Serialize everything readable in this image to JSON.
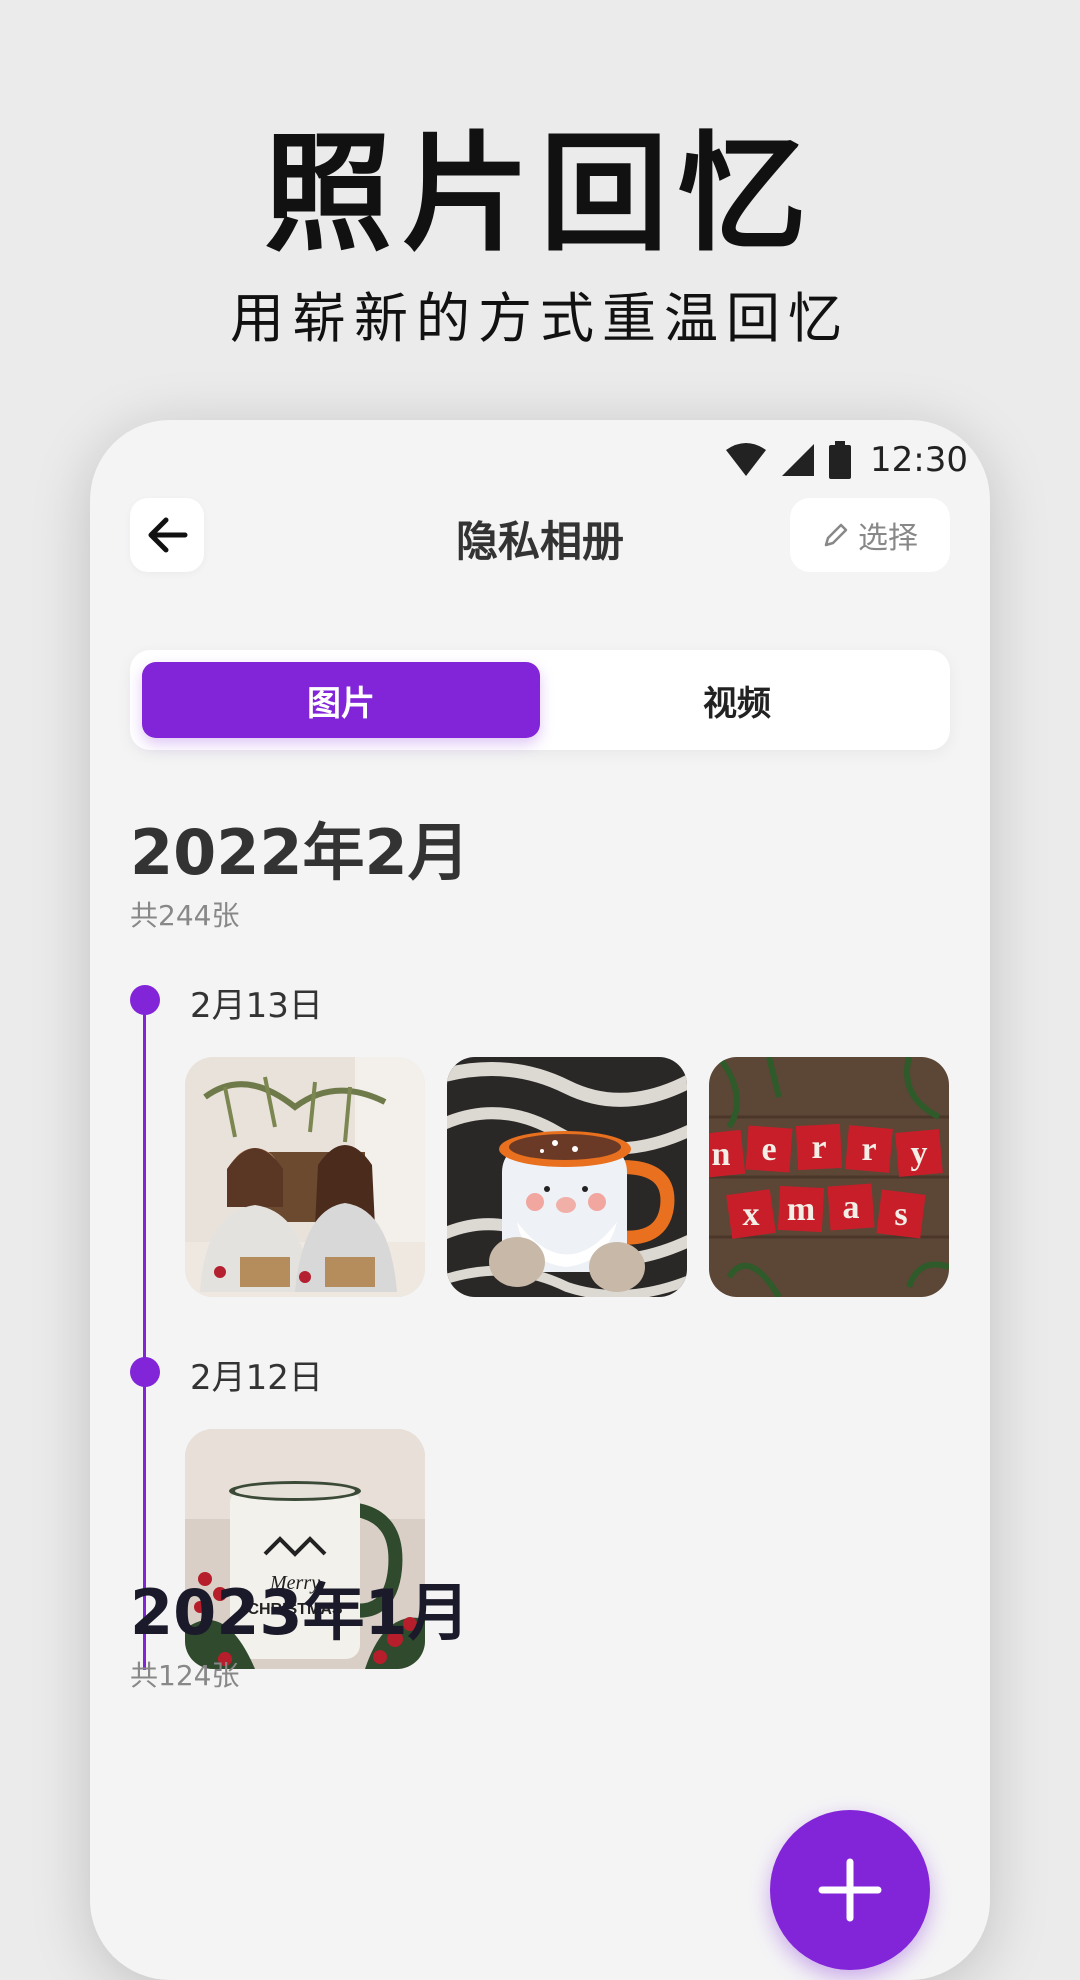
{
  "promo": {
    "title": "照片回忆",
    "subtitle": "用崭新的方式重温回忆"
  },
  "status_bar": {
    "time": "12:30",
    "icons": [
      "wifi-icon",
      "cellular-signal-icon",
      "battery-icon"
    ]
  },
  "header": {
    "back_icon": "arrow-left-icon",
    "title": "隐私相册",
    "select_label": "选择",
    "select_icon": "pencil-icon"
  },
  "tabs": [
    {
      "label": "图片",
      "active": true
    },
    {
      "label": "视频",
      "active": false
    }
  ],
  "sections": [
    {
      "month": "2022年2月",
      "count": "共244张",
      "days": [
        {
          "date": "2月13日",
          "photos": [
            "two-women-wrapping-gifts-photo",
            "santa-mug-cocoa-photo",
            "merry-xmas-letters-photo"
          ]
        },
        {
          "date": "2月12日",
          "photos": [
            "merry-christmas-mug-photo"
          ]
        }
      ]
    },
    {
      "month": "2023年1月",
      "count": "共124张",
      "days": []
    }
  ],
  "fab": {
    "icon": "plus-icon"
  },
  "colors": {
    "accent": "#8224d8",
    "background": "#ebebeb",
    "phone_background": "#f4f4f5"
  }
}
